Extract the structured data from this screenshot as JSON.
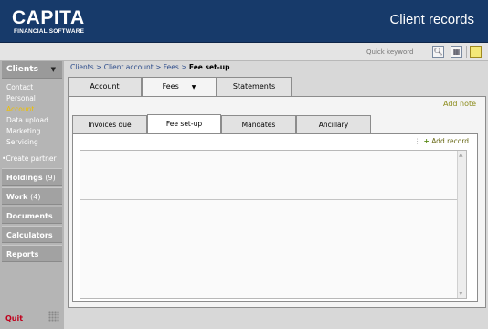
{
  "header": {
    "logo_main": "CAPITA",
    "logo_sub": "FINANCIAL SOFTWARE",
    "title": "Client records",
    "bg_color": "#173a6a"
  },
  "toolbar": {
    "search_placeholder": "Quick keyword",
    "icons": [
      "search-icon",
      "grid-icon",
      "note-icon"
    ]
  },
  "sidebar": {
    "clients_label": "Clients",
    "sub_items": [
      {
        "label": "Contact"
      },
      {
        "label": "Personal"
      },
      {
        "label": "Account"
      },
      {
        "label": "Data upload"
      },
      {
        "label": "Marketing"
      },
      {
        "label": "Servicing"
      }
    ],
    "active_sub_item": "Account",
    "create_partner": "Create partner",
    "sections": [
      {
        "label": "Holdings",
        "count": "(9)"
      },
      {
        "label": "Work",
        "count": "(4)"
      },
      {
        "label": "Documents",
        "count": ""
      },
      {
        "label": "Calculators",
        "count": ""
      },
      {
        "label": "Reports",
        "count": ""
      }
    ],
    "quit": "Quit"
  },
  "breadcrumb": {
    "items": [
      "Clients",
      "Client account",
      "Fees"
    ],
    "current": "Fee set-up",
    "separator": ">"
  },
  "main_tabs": [
    {
      "label": "Account"
    },
    {
      "label": "Fees"
    },
    {
      "label": "Statements"
    }
  ],
  "active_main_tab": "Fees",
  "add_note": "Add note",
  "sub_tabs": [
    {
      "label": "Invoices due"
    },
    {
      "label": "Fee set-up"
    },
    {
      "label": "Mandates"
    },
    {
      "label": "Ancillary"
    }
  ],
  "active_sub_tab": "Fee set-up",
  "add_record": "Add record"
}
